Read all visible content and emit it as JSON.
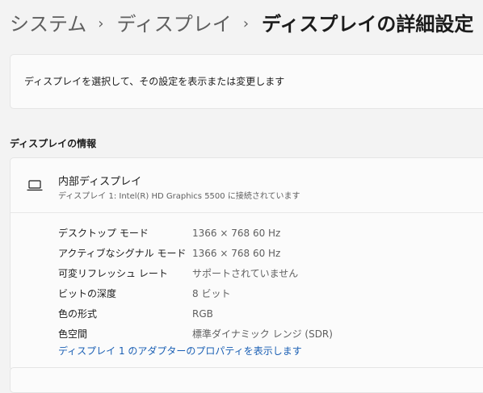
{
  "breadcrumb": {
    "items": [
      "システム",
      "ディスプレイ"
    ],
    "current": "ディスプレイの詳細設定",
    "separator": "›"
  },
  "select_display": {
    "text": "ディスプレイを選択して、その設定を表示または変更します"
  },
  "display_info": {
    "section_title": "ディスプレイの情報",
    "display_icon": "laptop-icon",
    "name": "内部ディスプレイ",
    "subtitle": "ディスプレイ 1: Intel(R) HD Graphics 5500 に接続されています",
    "rows": [
      {
        "label": "デスクトップ モード",
        "value": "1366 × 768 60 Hz"
      },
      {
        "label": "アクティブなシグナル モード",
        "value": "1366 × 768 60 Hz"
      },
      {
        "label": "可変リフレッシュ レート",
        "value": "サポートされていません"
      },
      {
        "label": "ビットの深度",
        "value": "8 ビット"
      },
      {
        "label": "色の形式",
        "value": "RGB"
      },
      {
        "label": "色空間",
        "value": "標準ダイナミック レンジ (SDR)"
      }
    ],
    "adapter_link": "ディスプレイ 1 のアダプターのプロパティを表示します"
  },
  "colors": {
    "background": "#f3f3f3",
    "card": "#fbfbfb",
    "link": "#1a5fb4",
    "secondary_text": "#5f5f5f"
  }
}
